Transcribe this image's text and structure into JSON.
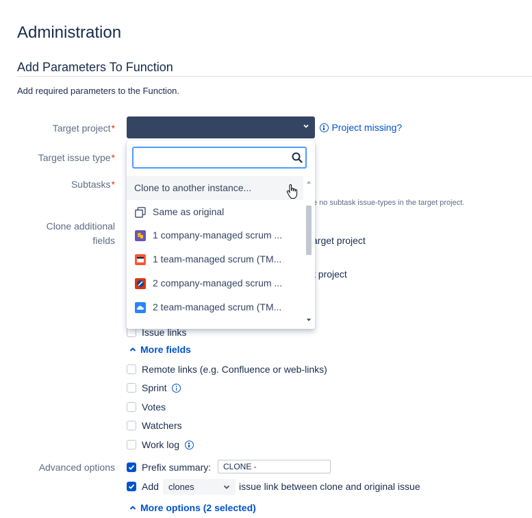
{
  "page": {
    "title": "Administration",
    "subtitle": "Add Parameters To Function",
    "description": "Add required parameters to the Function."
  },
  "labels": {
    "target_project": "Target project",
    "target_issue_type": "Target issue type",
    "subtasks": "Subtasks",
    "clone_additional_line1": "Clone additional",
    "clone_additional_line2": "fields",
    "advanced_options": "Advanced options",
    "required_mark": "*"
  },
  "project_missing": "Project missing?",
  "dropdown": {
    "search_placeholder": "",
    "options": [
      {
        "label": "Clone to another instance...",
        "icon": "none",
        "color": ""
      },
      {
        "label": "Same as original",
        "icon": "copy-icon",
        "color": "#42526e"
      },
      {
        "label": "1 company-managed scrum ...",
        "icon": "project-avatar-icon",
        "color": "#6554c0"
      },
      {
        "label": "1 team-managed scrum (TM...",
        "icon": "project-avatar-icon",
        "color": "#ff5630"
      },
      {
        "label": "2 company-managed scrum ...",
        "icon": "project-avatar-icon",
        "color": "#de350b"
      },
      {
        "label": "2 team-managed scrum (TM...",
        "icon": "project-avatar-icon",
        "color": "#2684ff"
      }
    ]
  },
  "behind_text": {
    "subtasks_note": "e no subtask issue-types in the target project.",
    "line1": "arget project",
    "line2": "t project"
  },
  "fields": {
    "issue_links": "Issue links",
    "more_fields": "More fields",
    "remote_links": "Remote links (e.g. Confluence or web-links)",
    "sprint": "Sprint",
    "votes": "Votes",
    "watchers": "Watchers",
    "work_log": "Work log"
  },
  "advanced": {
    "prefix_summary_label": "Prefix summary:",
    "prefix_value": "CLONE -",
    "add_label": "Add",
    "link_type": "clones",
    "link_suffix": "issue link between clone and original issue",
    "more_options": "More options (2 selected)"
  },
  "colors": {
    "select_bg": "#344563",
    "link": "#0052cc",
    "required": "#de350b"
  }
}
